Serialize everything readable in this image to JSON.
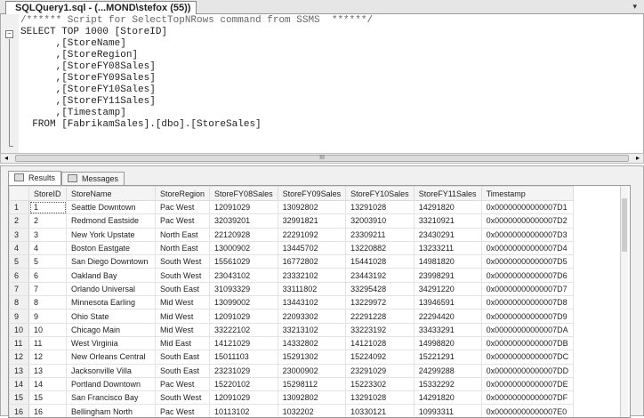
{
  "tab": {
    "title": "SQLQuery1.sql - (...MOND\\stefox (55))",
    "dropdown_icon": "▾"
  },
  "editor": {
    "comment": "/****** Script for SelectTopNRows command from SSMS  ******/",
    "lines": [
      "SELECT TOP 1000 [StoreID]",
      "      ,[StoreName]",
      "      ,[StoreRegion]",
      "      ,[StoreFY08Sales]",
      "      ,[StoreFY09Sales]",
      "      ,[StoreFY10Sales]",
      "      ,[StoreFY11Sales]",
      "      ,[Timestamp]",
      "  FROM [FabrikamSales].[dbo].[StoreSales]"
    ],
    "fold_icon": "−"
  },
  "scroll": {
    "left": "◂",
    "right": "▸",
    "grip": "III"
  },
  "results_tabs": [
    {
      "label": "Results"
    },
    {
      "label": "Messages"
    }
  ],
  "grid": {
    "columns": [
      "StoreID",
      "StoreName",
      "StoreRegion",
      "StoreFY08Sales",
      "StoreFY09Sales",
      "StoreFY10Sales",
      "StoreFY11Sales",
      "Timestamp"
    ],
    "rows": [
      [
        "1",
        "1",
        "Seattle Downtown",
        "Pac West",
        "12091029",
        "13092802",
        "13291028",
        "14291820",
        "0x00000000000007D1"
      ],
      [
        "2",
        "2",
        "Redmond Eastside",
        "Pac West",
        "32039201",
        "32991821",
        "32003910",
        "33210921",
        "0x00000000000007D2"
      ],
      [
        "3",
        "3",
        "New York Upstate",
        "North East",
        "22120928",
        "22291092",
        "23309211",
        "23430291",
        "0x00000000000007D3"
      ],
      [
        "4",
        "4",
        "Boston Eastgate",
        "North East",
        "13000902",
        "13445702",
        "13220882",
        "13233211",
        "0x00000000000007D4"
      ],
      [
        "5",
        "5",
        "San Diego Downtown",
        "South West",
        "15561029",
        "16772802",
        "15441028",
        "14981820",
        "0x00000000000007D5"
      ],
      [
        "6",
        "6",
        "Oakland Bay",
        "South West",
        "23043102",
        "23332102",
        "23443192",
        "23998291",
        "0x00000000000007D6"
      ],
      [
        "7",
        "7",
        "Orlando Universal",
        "South East",
        "31093329",
        "33111802",
        "33295428",
        "34291220",
        "0x00000000000007D7"
      ],
      [
        "8",
        "8",
        "Minnesota Earling",
        "Mid West",
        "13099002",
        "13443102",
        "13229972",
        "13946591",
        "0x00000000000007D8"
      ],
      [
        "9",
        "9",
        "Ohio State",
        "Mid West",
        "12091029",
        "22093302",
        "22291228",
        "22294420",
        "0x00000000000007D9"
      ],
      [
        "10",
        "10",
        "Chicago Main",
        "Mid West",
        "33222102",
        "33213102",
        "33223192",
        "33433291",
        "0x00000000000007DA"
      ],
      [
        "11",
        "11",
        "West Virginia",
        "Mid East",
        "14121029",
        "14332802",
        "14121028",
        "14998820",
        "0x00000000000007DB"
      ],
      [
        "12",
        "12",
        "New Orleans Central",
        "South East",
        "15011103",
        "15291302",
        "15224092",
        "15221291",
        "0x00000000000007DC"
      ],
      [
        "13",
        "13",
        "Jacksonville Villa",
        "South East",
        "23231029",
        "23000902",
        "23291029",
        "24299288",
        "0x00000000000007DD"
      ],
      [
        "14",
        "14",
        "Portland Downtown",
        "Pac West",
        "15220102",
        "15298112",
        "15223302",
        "15332292",
        "0x00000000000007DE"
      ],
      [
        "15",
        "15",
        "San Francisco Bay",
        "South West",
        "12091029",
        "13092802",
        "13291028",
        "14291820",
        "0x00000000000007DF"
      ],
      [
        "16",
        "16",
        "Bellingham North",
        "Pac West",
        "10113102",
        "1032202",
        "10330121",
        "10993311",
        "0x00000000000007E0"
      ]
    ]
  }
}
